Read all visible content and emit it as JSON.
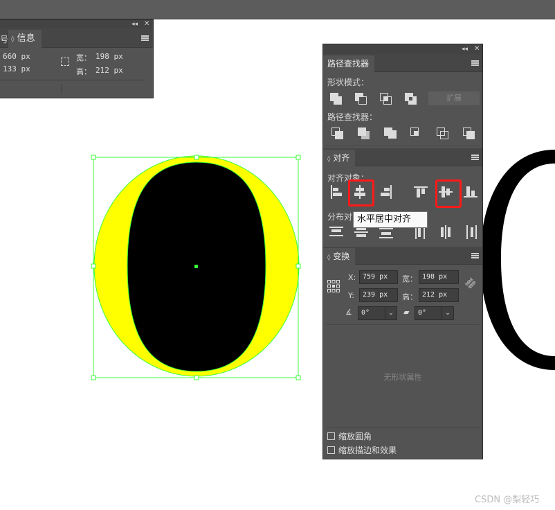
{
  "info_panel": {
    "prev_tab_glyph": "号",
    "tab_label": "信息",
    "x_value": "660 px",
    "y_value": "133 px",
    "width_label": "宽：",
    "width_value": "198 px",
    "height_label": "高：",
    "height_value": "212 px"
  },
  "pathfinder": {
    "tab_label": "路径查找器",
    "shape_modes_label": "形状模式：",
    "expand_label": "扩展",
    "pathfinders_label": "路径查找器："
  },
  "align": {
    "tab_label": "对齐",
    "align_objects_label": "对齐对象：",
    "distribute_label": "分布对",
    "tooltip": "水平居中对齐"
  },
  "transform": {
    "tab_label": "变换",
    "x_label": "X:",
    "x_value": "759 px",
    "y_label": "Y:",
    "y_value": "239 px",
    "w_label": "宽：",
    "w_value": "198 px",
    "h_label": "高：",
    "h_value": "212 px",
    "angle_value": "0°",
    "shear_value": "0°",
    "no_shape_props": "无形状属性",
    "scale_corners_label": "缩放圆角",
    "scale_strokes_label": "缩放描边和效果"
  },
  "watermark": "CSDN @梨轻巧",
  "colors": {
    "panel_bg": "#535353",
    "selection": "#39ff39",
    "shape_fill": "#ffff00",
    "highlight": "#ff1a1a"
  }
}
